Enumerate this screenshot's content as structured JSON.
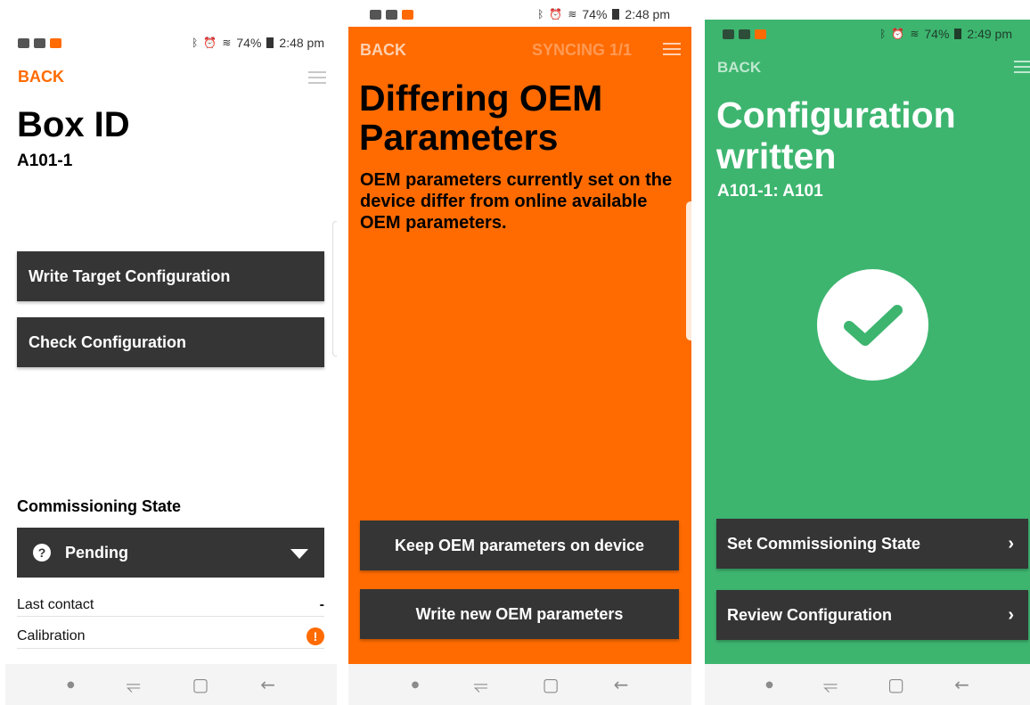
{
  "status_bar": {
    "battery": "74%",
    "time_1": "2:48 pm",
    "time_2": "2:48 pm",
    "time_3": "2:49 pm",
    "icons": [
      "gallery-icon",
      "message-icon",
      "app-notification-icon",
      "bluetooth-icon",
      "alarm-icon",
      "wifi-icon",
      "signal-icon",
      "battery-icon"
    ]
  },
  "screen1": {
    "back_label": "BACK",
    "title": "Box ID",
    "subtitle": "A101-1",
    "write_target_label": "Write Target Configuration",
    "check_config_label": "Check Configuration",
    "commissioning_heading": "Commissioning State",
    "commissioning_value": "Pending",
    "rows": [
      {
        "label": "Last contact",
        "value": "-"
      },
      {
        "label": "Calibration",
        "value": "!"
      }
    ],
    "accent": "#ff6b00"
  },
  "screen2": {
    "back_label": "BACK",
    "syncing_label": "SYNCING 1/1",
    "title": "Differing OEM Parameters",
    "message": "OEM parameters currently set on the device differ from online available OEM parameters.",
    "keep_label": "Keep OEM parameters on device",
    "write_new_label": "Write new OEM parameters",
    "background": "#ff6b00"
  },
  "screen3": {
    "back_label": "BACK",
    "title": "Configuration written",
    "subtitle": "A101-1: A101",
    "set_state_label": "Set Commissioning State",
    "review_label": "Review Configuration",
    "background": "#3db56f"
  },
  "navbar": {
    "icons": [
      "dot-icon",
      "recent-apps-icon",
      "home-icon",
      "back-arrow-icon"
    ]
  }
}
